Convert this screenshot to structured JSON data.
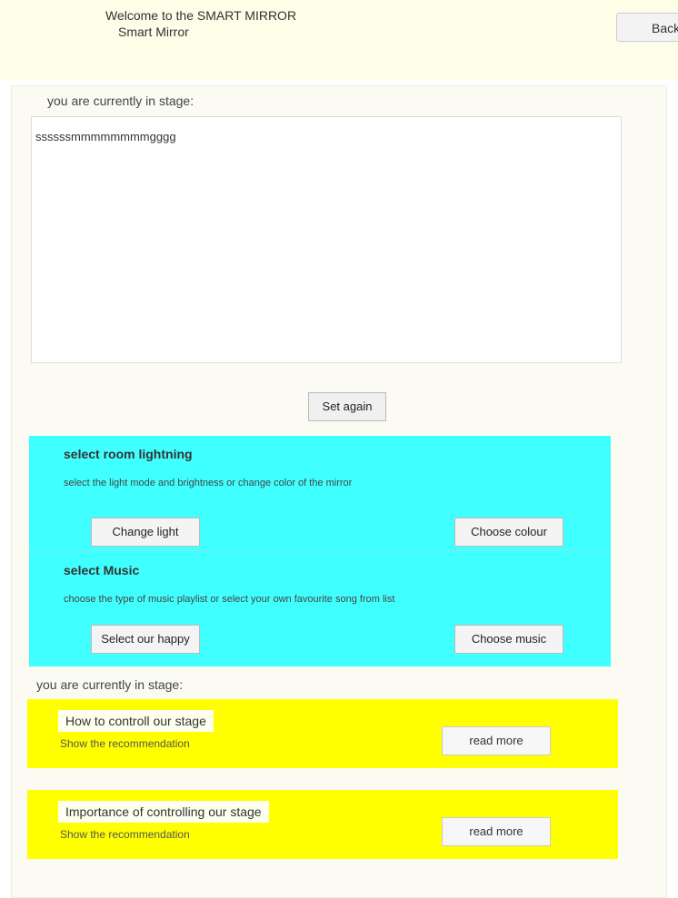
{
  "header": {
    "welcome_line1": "Welcome to the SMART MIRROR",
    "welcome_line2": "Smart Mirror",
    "top_button": "Back"
  },
  "main": {
    "stage_label": "you are currently in stage:",
    "text_content": "ssssssmmmmmmmmgggg",
    "set_button": "Set again"
  },
  "cyan_sections": [
    {
      "title": "select room lightning",
      "description": "select the light mode and brightness or change color of the mirror",
      "left_button": "Change light",
      "right_button": "Choose colour"
    },
    {
      "title": "select Music",
      "description": "choose the type of music playlist or select your own favourite song from list",
      "left_button": "Select our happy",
      "right_button": "Choose music"
    }
  ],
  "stage_label_2": "you are currently in stage:",
  "yellow_cards": [
    {
      "title": "How to controll our stage",
      "subtitle": "Show the recommendation",
      "button": "read more"
    },
    {
      "title": "Importance of controlling our stage",
      "subtitle": "Show the recommendation",
      "button": "read more"
    }
  ],
  "colors": {
    "topbar": "#fefde8",
    "cyan_section": "#40ffff",
    "yellow_card": "#ffff00"
  }
}
